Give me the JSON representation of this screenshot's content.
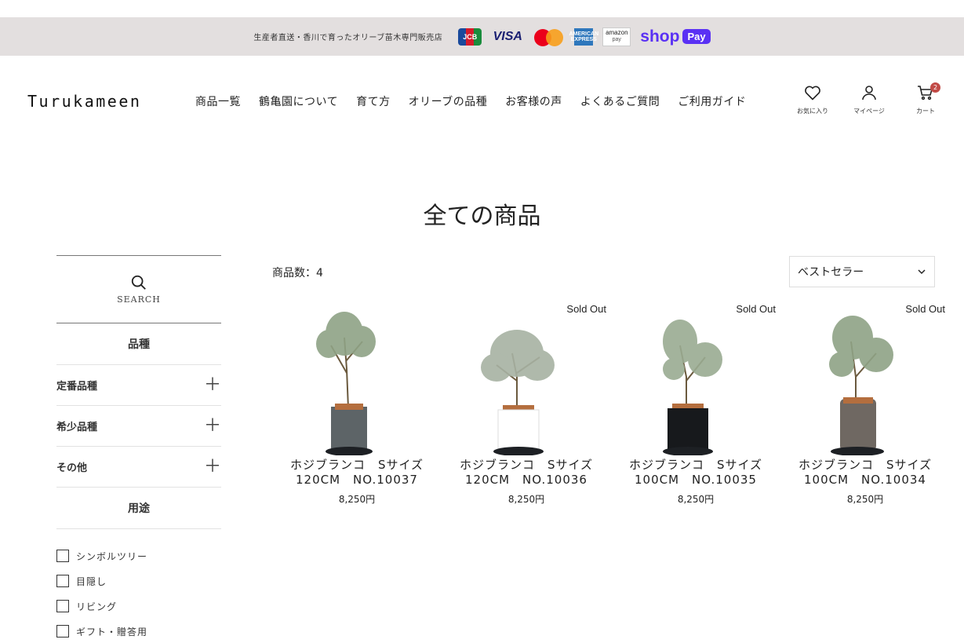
{
  "topbar": {
    "notice": "生産者直送・香川で育ったオリーブ苗木専門販売店",
    "payments": {
      "jcb": "JCB",
      "visa": "VISA",
      "amex": "AMERICAN EXPRESS",
      "amazon_top": "amazon",
      "amazon_bottom": "pay",
      "shop": "shop",
      "shop_pill": "Pay"
    }
  },
  "header": {
    "logo": "Turukameen",
    "nav": [
      "商品一覧",
      "鶴亀園について",
      "育て方",
      "オリーブの品種",
      "お客様の声",
      "よくあるご質問",
      "ご利用ガイド"
    ],
    "icons": {
      "favorites": "お気に入り",
      "mypage": "マイページ",
      "cart": "カート",
      "cart_count": "2"
    }
  },
  "page_title": "全ての商品",
  "sidebar": {
    "search_label": "SEARCH",
    "variety_heading": "品種",
    "categories": [
      "定番品種",
      "希少品種",
      "その他"
    ],
    "use_heading": "用途",
    "uses": [
      "シンボルツリー",
      "目隠し",
      "リビング",
      "ギフト・贈答用"
    ]
  },
  "listing": {
    "count_label": "商品数：4",
    "sort_selected": "ベストセラー",
    "products": [
      {
        "name1": "ホジブランコ　Sサイズ",
        "name2": "120CM　NO.10037",
        "price": "8,250円",
        "sold_out": ""
      },
      {
        "name1": "ホジブランコ　Sサイズ",
        "name2": "120CM　NO.10036",
        "price": "8,250円",
        "sold_out": "Sold Out"
      },
      {
        "name1": "ホジブランコ　Sサイズ",
        "name2": "100CM　NO.10035",
        "price": "8,250円",
        "sold_out": "Sold Out"
      },
      {
        "name1": "ホジブランコ　Sサイズ",
        "name2": "100CM　NO.10034",
        "price": "8,250円",
        "sold_out": "Sold Out"
      }
    ]
  },
  "colors": {
    "topbar_bg": "#e3dfdf",
    "badge": "#c24b47",
    "shop_purple": "#5a31f4"
  }
}
